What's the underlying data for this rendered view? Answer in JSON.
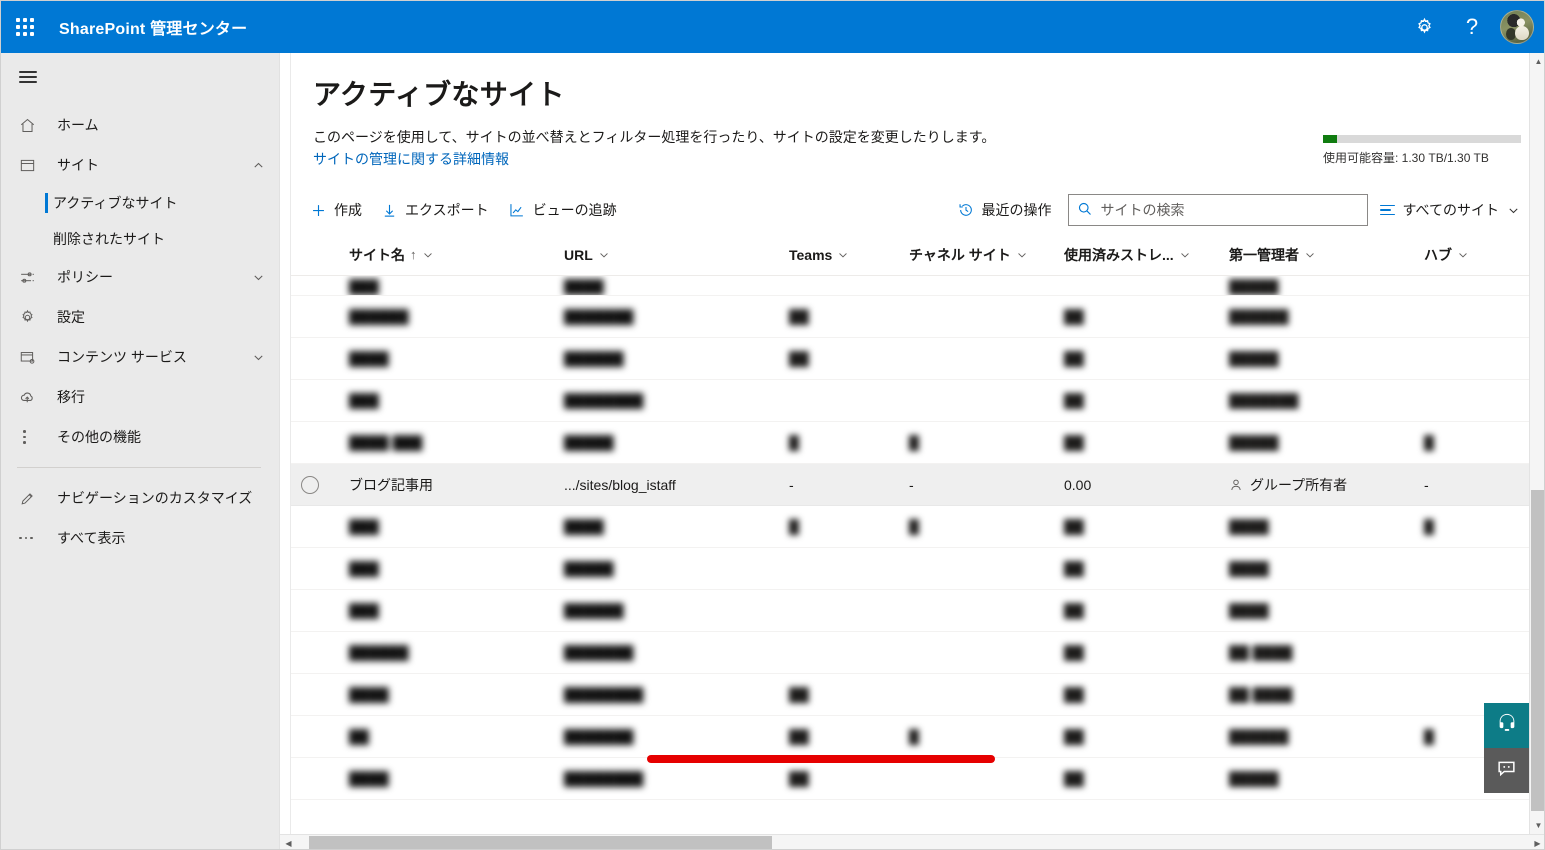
{
  "suite": {
    "title": "SharePoint 管理センター",
    "waffle_icon": "app-launcher-icon",
    "settings_icon": "gear-icon",
    "help_icon": "help-question-icon",
    "help_label": "?",
    "avatar_icon": "user-avatar"
  },
  "sidebar": {
    "toggle_icon": "hamburger-icon",
    "items": [
      {
        "label": "ホーム",
        "icon": "home-icon",
        "chevron": ""
      },
      {
        "label": "サイト",
        "icon": "sites-icon",
        "chevron": "⌃"
      },
      {
        "label": "ポリシー",
        "icon": "policies-icon",
        "chevron": "⌄"
      },
      {
        "label": "設定",
        "icon": "settings-gear-icon",
        "chevron": ""
      },
      {
        "label": "コンテンツ サービス",
        "icon": "content-services-icon",
        "chevron": "⌄"
      },
      {
        "label": "移行",
        "icon": "migration-cloud-icon",
        "chevron": ""
      },
      {
        "label": "その他の機能",
        "icon": "more-features-icon",
        "chevron": ""
      },
      {
        "label": "ナビゲーションのカスタマイズ",
        "icon": "pencil-icon",
        "chevron": ""
      },
      {
        "label": "すべて表示",
        "icon": "ellipsis-icon",
        "chevron": ""
      }
    ],
    "sub_items": [
      {
        "label": "アクティブなサイト",
        "selected": true
      },
      {
        "label": "削除されたサイト",
        "selected": false
      }
    ]
  },
  "page": {
    "title": "アクティブなサイト",
    "description": "このページを使用して、サイトの並べ替えとフィルター処理を行ったり、サイトの設定を変更したりします。",
    "link": "サイトの管理に関する詳細情報"
  },
  "storage": {
    "label": "使用可能容量: 1.30 TB/1.30 TB",
    "fill_color": "#107c10",
    "fill_percent": 7
  },
  "commandbar": {
    "create": {
      "label": "作成",
      "icon": "plus-icon"
    },
    "export": {
      "label": "エクスポート",
      "icon": "download-arrow-icon"
    },
    "track_views": {
      "label": "ビューの追跡",
      "icon": "chart-line-icon"
    },
    "recent": {
      "label": "最近の操作",
      "icon": "history-clock-icon"
    },
    "search": {
      "placeholder": "サイトの検索",
      "value": "",
      "icon": "search-icon"
    },
    "view": {
      "label": "すべてのサイト",
      "icon": "filter-lines-icon",
      "chevron": "⌄"
    }
  },
  "table": {
    "columns": [
      {
        "key": "name",
        "label": "サイト名",
        "sort": "↑",
        "chevron": "⌄"
      },
      {
        "key": "url",
        "label": "URL",
        "sort": "",
        "chevron": "⌄"
      },
      {
        "key": "teams",
        "label": "Teams",
        "sort": "",
        "chevron": "⌄"
      },
      {
        "key": "chan",
        "label": "チャネル サイト",
        "sort": "",
        "chevron": "⌄"
      },
      {
        "key": "store",
        "label": "使用済みストレ...",
        "sort": "",
        "chevron": "⌄"
      },
      {
        "key": "admin",
        "label": "第一管理者",
        "sort": "",
        "chevron": "⌄"
      },
      {
        "key": "hub",
        "label": "ハブ",
        "sort": "",
        "chevron": "⌄"
      }
    ],
    "rows": [
      {
        "state": "clipped",
        "redacted": true,
        "name": "███",
        "url": "████",
        "teams": "",
        "chan": "",
        "store": "",
        "admin": "█████",
        "hub": ""
      },
      {
        "state": "normal",
        "redacted": true,
        "name": "██████",
        "url": "███████",
        "teams": "██",
        "chan": "",
        "store": "██",
        "admin": "██████",
        "hub": ""
      },
      {
        "state": "normal",
        "redacted": true,
        "name": "████",
        "url": "██████",
        "teams": "██",
        "chan": "",
        "store": "██",
        "admin": "█████",
        "hub": ""
      },
      {
        "state": "normal",
        "redacted": true,
        "name": "███",
        "url": "████████",
        "teams": "",
        "chan": "",
        "store": "██",
        "admin": "███████",
        "hub": ""
      },
      {
        "state": "normal",
        "redacted": true,
        "name": "████ ███",
        "url": "█████",
        "teams": "█",
        "chan": "█",
        "store": "██",
        "admin": "█████",
        "hub": "█"
      },
      {
        "state": "selected",
        "redacted": false,
        "name": "ブログ記事用",
        "url": ".../sites/blog_istaff",
        "teams": "-",
        "chan": "-",
        "store": "0.00",
        "admin": "グループ所有者",
        "admin_icon": "person-icon",
        "hub": "-"
      },
      {
        "state": "normal",
        "redacted": true,
        "name": "███",
        "url": "████",
        "teams": "█",
        "chan": "█",
        "store": "██",
        "admin": "████",
        "hub": "█"
      },
      {
        "state": "normal",
        "redacted": true,
        "name": "███",
        "url": "█████",
        "teams": "",
        "chan": "",
        "store": "██",
        "admin": "████",
        "hub": ""
      },
      {
        "state": "normal",
        "redacted": true,
        "name": "███",
        "url": "██████",
        "teams": "",
        "chan": "",
        "store": "██",
        "admin": "████",
        "hub": ""
      },
      {
        "state": "normal",
        "redacted": true,
        "name": "██████",
        "url": "███████",
        "teams": "",
        "chan": "",
        "store": "██",
        "admin": "██ ████",
        "hub": ""
      },
      {
        "state": "normal",
        "redacted": true,
        "name": "████",
        "url": "████████",
        "teams": "██",
        "chan": "",
        "store": "██",
        "admin": "██ ████",
        "hub": ""
      },
      {
        "state": "normal",
        "redacted": true,
        "name": "██",
        "url": "███████",
        "teams": "██",
        "chan": "█",
        "store": "██",
        "admin": "██████",
        "hub": "█"
      },
      {
        "state": "normal",
        "redacted": true,
        "name": "████",
        "url": "████████",
        "teams": "██",
        "chan": "",
        "store": "██",
        "admin": "█████",
        "hub": ""
      }
    ],
    "annotation": {
      "type": "red-underline",
      "target_row": 5,
      "color": "#e60000"
    }
  },
  "float_buttons": {
    "support": {
      "icon": "headset-support-icon",
      "color": "#0d7c87"
    },
    "feedback": {
      "icon": "feedback-chat-icon",
      "color": "#5a5a5a"
    }
  },
  "scrollbars": {
    "vertical": {
      "thumb_top_percent": 56,
      "thumb_height_percent": 41
    },
    "horizontal": {
      "thumb_left_percent": 1,
      "thumb_width_percent": 37
    }
  }
}
